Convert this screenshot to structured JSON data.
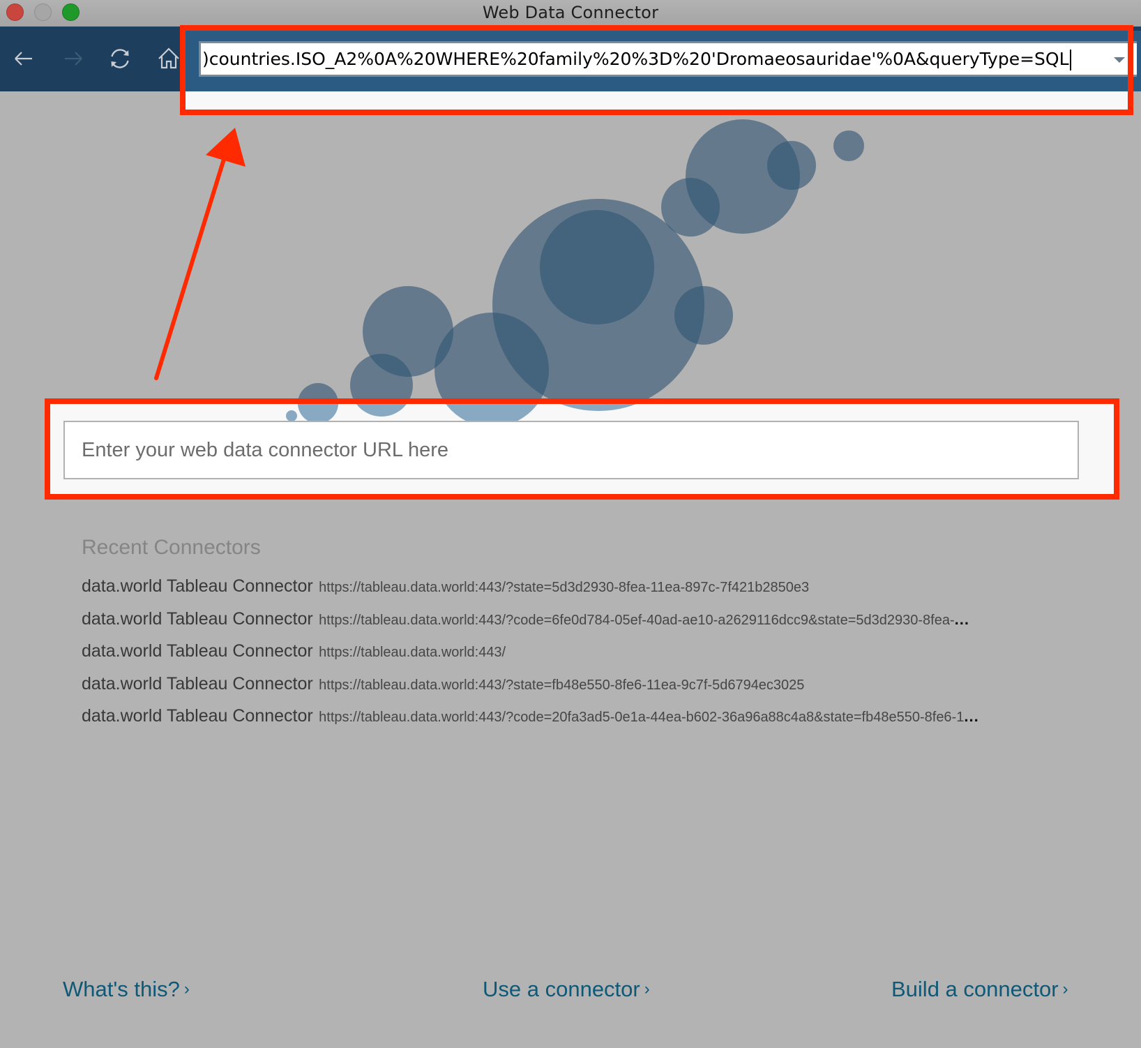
{
  "window": {
    "title": "Web Data Connector",
    "controls": [
      "close",
      "minimize",
      "maximize"
    ]
  },
  "toolbar": {
    "back_icon": "arrow-left-icon",
    "forward_icon": "arrow-right-icon",
    "refresh_icon": "refresh-icon",
    "home_icon": "home-icon",
    "address_value": ")countries.ISO_A2%0A%20WHERE%20family%20%3D%20'Dromaeosauridae'%0A&queryType=SQL",
    "address_dropdown_icon": "chevron-down-icon"
  },
  "main": {
    "url_input": {
      "value": "",
      "placeholder": "Enter your web data connector URL here"
    },
    "recent": {
      "title": "Recent Connectors",
      "items": [
        {
          "name": "data.world Tableau Connector",
          "url": "https://tableau.data.world:443/?state=5d3d2930-8fea-11ea-897c-7f421b2850e3",
          "truncated": false
        },
        {
          "name": "data.world Tableau Connector",
          "url": "https://tableau.data.world:443/?code=6fe0d784-05ef-40ad-ae10-a2629116dcc9&state=5d3d2930-8fea-",
          "truncated": true
        },
        {
          "name": "data.world Tableau Connector",
          "url": "https://tableau.data.world:443/",
          "truncated": false
        },
        {
          "name": "data.world Tableau Connector",
          "url": "https://tableau.data.world:443/?state=fb48e550-8fe6-11ea-9c7f-5d6794ec3025",
          "truncated": false
        },
        {
          "name": "data.world Tableau Connector",
          "url": "https://tableau.data.world:443/?code=20fa3ad5-0e1a-44ea-b602-36a96a88c4a8&state=fb48e550-8fe6-1",
          "truncated": true
        }
      ],
      "ellipsis": "..."
    }
  },
  "footer": {
    "links": [
      {
        "label": "What's this?",
        "chevron": "›"
      },
      {
        "label": "Use a connector",
        "chevron": "›"
      },
      {
        "label": "Build a connector",
        "chevron": "›"
      }
    ]
  },
  "annotations": {
    "highlight_color": "#ff2a00",
    "callouts": [
      "address-bar-highlight",
      "url-input-highlight",
      "arrow-from-input-to-address-bar"
    ]
  },
  "colors": {
    "toolbar": "#1d3e5c",
    "address_region": "#2b5b82",
    "background": "#b3b3b3",
    "link": "#0e5878",
    "bubble": "#4a6880"
  }
}
